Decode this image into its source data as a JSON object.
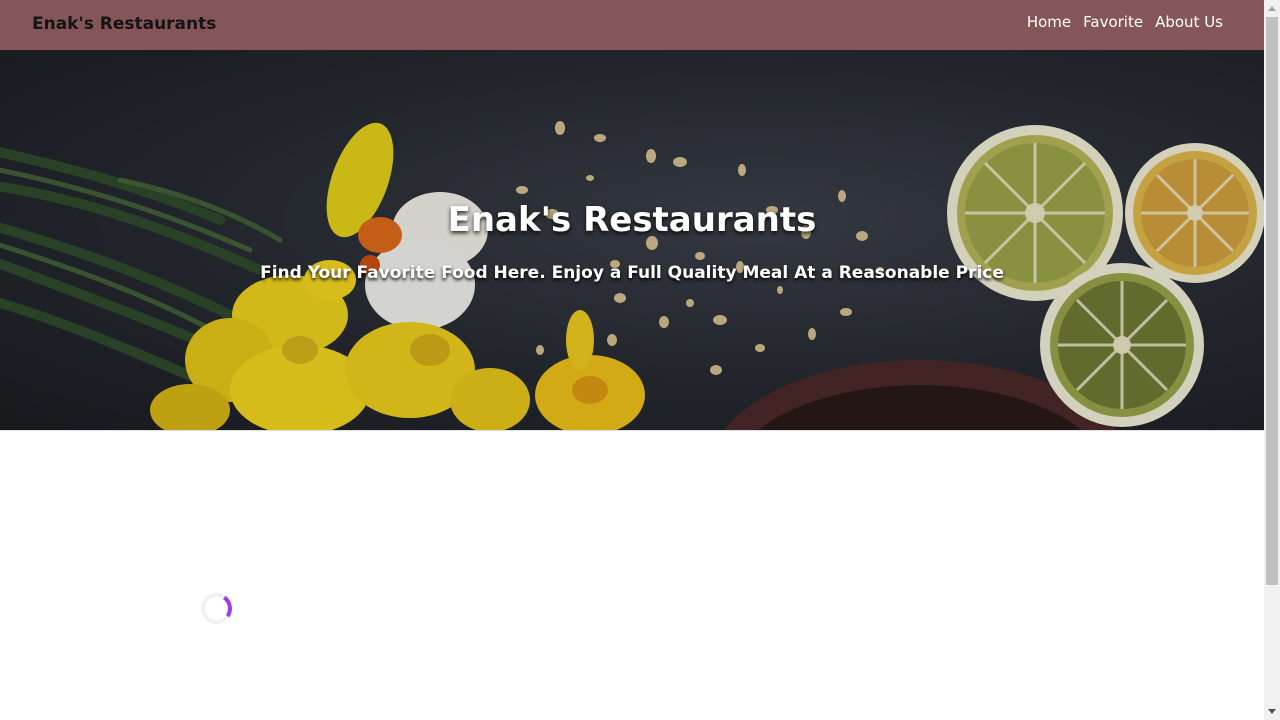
{
  "header": {
    "brand": "Enak's Restaurants",
    "nav": [
      "Home",
      "Favorite",
      "About Us"
    ]
  },
  "hero": {
    "title": "Enak's Restaurants",
    "tagline": "Find Your Favorite Food Here. Enjoy a Full Quality Meal At a Reasonable Price"
  },
  "colors": {
    "appbar": "#845659",
    "spinner_accent": "#9b3cf3"
  }
}
